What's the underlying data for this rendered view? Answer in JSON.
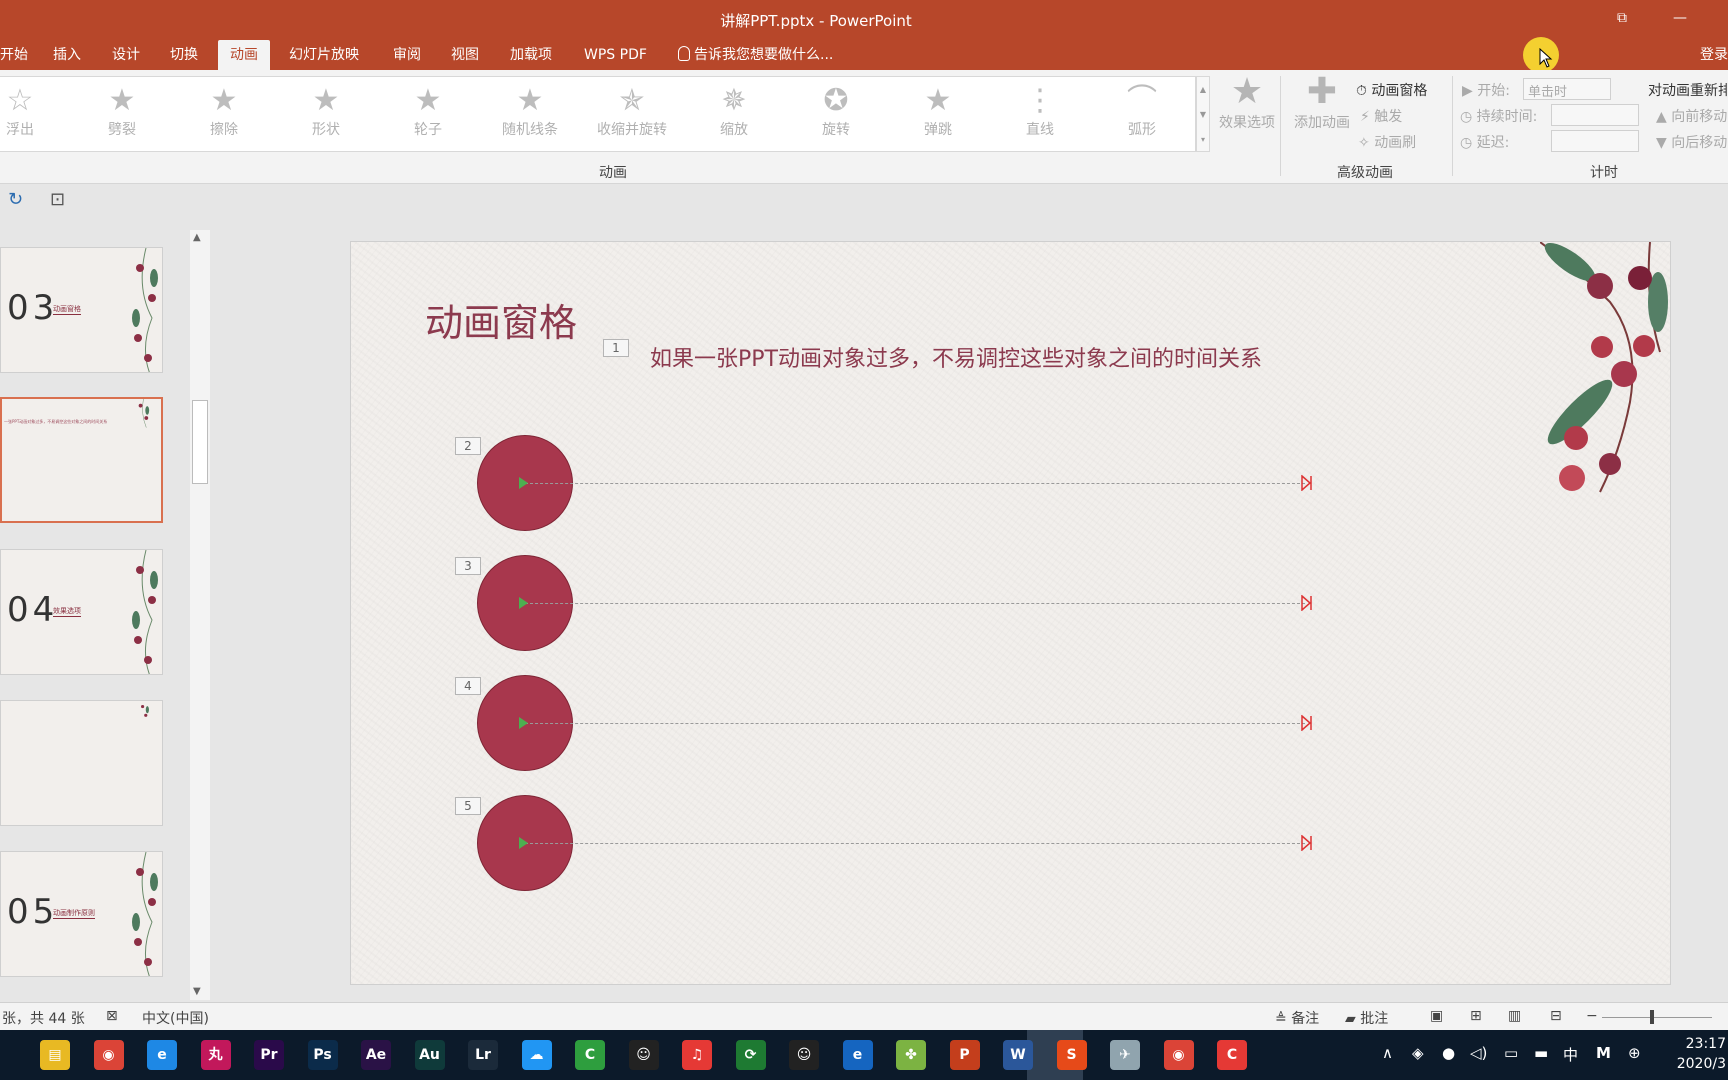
{
  "window": {
    "title": "讲解PPT.pptx - PowerPoint",
    "restore_label": "⧉",
    "minimize_label": "—",
    "login": "登录"
  },
  "tabs": [
    "开始",
    "插入",
    "设计",
    "切换",
    "动画",
    "幻灯片放映",
    "审阅",
    "视图",
    "加载项",
    "WPS PDF"
  ],
  "tell_me": "告诉我您想要做什么...",
  "ribbon": {
    "animations": [
      {
        "label": "浮出",
        "icon": "float-out-star-icon"
      },
      {
        "label": "劈裂",
        "icon": "split-star-icon"
      },
      {
        "label": "擦除",
        "icon": "wipe-star-icon"
      },
      {
        "label": "形状",
        "icon": "shape-star-icon"
      },
      {
        "label": "轮子",
        "icon": "wheel-star-icon"
      },
      {
        "label": "随机线条",
        "icon": "random-bars-star-icon"
      },
      {
        "label": "收缩并旋转",
        "icon": "shrink-turn-star-icon"
      },
      {
        "label": "缩放",
        "icon": "zoom-star-icon"
      },
      {
        "label": "旋转",
        "icon": "swivel-star-icon"
      },
      {
        "label": "弹跳",
        "icon": "bounce-star-icon"
      },
      {
        "label": "直线",
        "icon": "lines-path-icon"
      },
      {
        "label": "弧形",
        "icon": "arcs-path-icon"
      }
    ],
    "group_animation": "动画",
    "effect_options": "效果选项",
    "add_animation": "添加动画",
    "animation_pane": "动画窗格",
    "trigger": "触发",
    "animation_painter": "动画刷",
    "group_advanced": "高级动画",
    "start_label": "开始:",
    "start_value": "单击时",
    "duration_label": "持续时间:",
    "delay_label": "延迟:",
    "reorder_label": "对动画重新排序",
    "move_earlier": "向前移动",
    "move_later": "向后移动",
    "group_timing": "计时"
  },
  "thumbnails": [
    {
      "num": "03",
      "caption": "动画窗格"
    },
    {
      "num": "",
      "caption": "",
      "tiny": "一张PPT动画对象过多，不易调控这些对象之间的时间关系"
    },
    {
      "num": "04",
      "caption": "效果选项"
    },
    {
      "num": "",
      "caption": ""
    },
    {
      "num": "05",
      "caption": "动画制作原则"
    }
  ],
  "slide": {
    "title": "动画窗格",
    "subtitle": "如果一张PPT动画对象过多，不易调控这些对象之间的时间关系",
    "tags": [
      "1",
      "2",
      "3",
      "4",
      "5"
    ]
  },
  "status": {
    "slide_info": "张，共 44 张",
    "language": "中文(中国)",
    "notes": "备注",
    "comments": "批注"
  },
  "taskbar": {
    "apps": [
      "file-explorer",
      "chrome",
      "ie",
      "app-wan",
      "premiere",
      "photoshop",
      "after-effects",
      "audition",
      "lightroom",
      "baidu-netdisk",
      "camtasia",
      "qq",
      "netease-music",
      "wechat-mini",
      "qq2",
      "edge",
      "clover",
      "powerpoint",
      "word",
      "sogou",
      "kite",
      "chrome2",
      "snagit"
    ],
    "ime": "中",
    "time": "23:17",
    "date": "2020/3"
  },
  "colors": {
    "accent": "#b7472a",
    "slide_text": "#8c3a4e",
    "circle": "#a8374d"
  }
}
